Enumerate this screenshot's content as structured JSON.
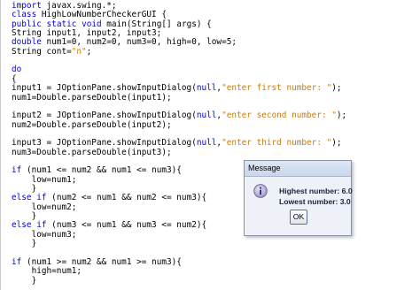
{
  "editor": {
    "lines": [
      [
        {
          "t": "import",
          "c": "kw"
        },
        {
          "t": " javax.swing.*;",
          "c": ""
        }
      ],
      [
        {
          "t": "class",
          "c": "kw"
        },
        {
          "t": " HighLowNumberCheckerGUI {",
          "c": ""
        }
      ],
      [
        {
          "t": "public",
          "c": "kw"
        },
        {
          "t": " ",
          "c": ""
        },
        {
          "t": "static",
          "c": "kw"
        },
        {
          "t": " ",
          "c": ""
        },
        {
          "t": "void",
          "c": "kw"
        },
        {
          "t": " main(String[] args) {",
          "c": ""
        }
      ],
      [
        {
          "t": "String input1, input2, input3;",
          "c": ""
        }
      ],
      [
        {
          "t": "double",
          "c": "kw"
        },
        {
          "t": " num1=0, num2=0, num3=0, high=0, low=5;",
          "c": ""
        }
      ],
      [
        {
          "t": "String cont=",
          "c": ""
        },
        {
          "t": "\"n\"",
          "c": "str"
        },
        {
          "t": ";",
          "c": ""
        }
      ],
      [],
      [
        {
          "t": "do",
          "c": "kw"
        }
      ],
      [
        {
          "t": "{",
          "c": ""
        }
      ],
      [
        {
          "t": "input1 = JOptionPane.showInputDialog(",
          "c": ""
        },
        {
          "t": "null",
          "c": "kw"
        },
        {
          "t": ",",
          "c": ""
        },
        {
          "t": "\"enter first number: \"",
          "c": "str"
        },
        {
          "t": ");",
          "c": ""
        }
      ],
      [
        {
          "t": "num1=Double.parseDouble(input1);",
          "c": ""
        }
      ],
      [],
      [
        {
          "t": "input2 = JOptionPane.showInputDialog(",
          "c": ""
        },
        {
          "t": "null",
          "c": "kw"
        },
        {
          "t": ",",
          "c": ""
        },
        {
          "t": "\"enter second number: \"",
          "c": "str"
        },
        {
          "t": ");",
          "c": ""
        }
      ],
      [
        {
          "t": "num2=Double.parseDouble(input2);",
          "c": ""
        }
      ],
      [],
      [
        {
          "t": "input3 = JOptionPane.showInputDialog(",
          "c": ""
        },
        {
          "t": "null",
          "c": "kw"
        },
        {
          "t": ",",
          "c": ""
        },
        {
          "t": "\"enter third number: \"",
          "c": "str"
        },
        {
          "t": ");",
          "c": ""
        }
      ],
      [
        {
          "t": "num3=Double.parseDouble(input3);",
          "c": ""
        }
      ],
      [],
      [
        {
          "t": "if",
          "c": "kw"
        },
        {
          "t": " (num1 <= num2 && num1 <= num3){",
          "c": ""
        }
      ],
      [
        {
          "t": "    low=num1;",
          "c": ""
        }
      ],
      [
        {
          "t": "    }",
          "c": ""
        }
      ],
      [
        {
          "t": "else",
          "c": "kw"
        },
        {
          "t": " ",
          "c": ""
        },
        {
          "t": "if",
          "c": "kw"
        },
        {
          "t": " (num2 <= num1 && num2 <= num3){",
          "c": ""
        }
      ],
      [
        {
          "t": "    low=num2;",
          "c": ""
        }
      ],
      [
        {
          "t": "    }",
          "c": ""
        }
      ],
      [
        {
          "t": "else",
          "c": "kw"
        },
        {
          "t": " ",
          "c": ""
        },
        {
          "t": "if",
          "c": "kw"
        },
        {
          "t": " (num3 <= num1 && num3 <= num2){",
          "c": ""
        }
      ],
      [
        {
          "t": "    low=num3;",
          "c": ""
        }
      ],
      [
        {
          "t": "    }",
          "c": ""
        }
      ],
      [],
      [
        {
          "t": "if",
          "c": "kw"
        },
        {
          "t": " (num1 >= num2 && num1 >= num3){",
          "c": ""
        }
      ],
      [
        {
          "t": "    high=num1;",
          "c": ""
        }
      ],
      [
        {
          "t": "    }",
          "c": ""
        }
      ]
    ],
    "colors": {
      "keyword": "#0000e6",
      "string": "#ce7b00",
      "text": "#000000"
    }
  },
  "dialog": {
    "title": "Message",
    "icon": "info-icon",
    "highest": "Highest number: 6.0",
    "lowest": "Lowest number: 3.0",
    "ok_label": "OK"
  }
}
